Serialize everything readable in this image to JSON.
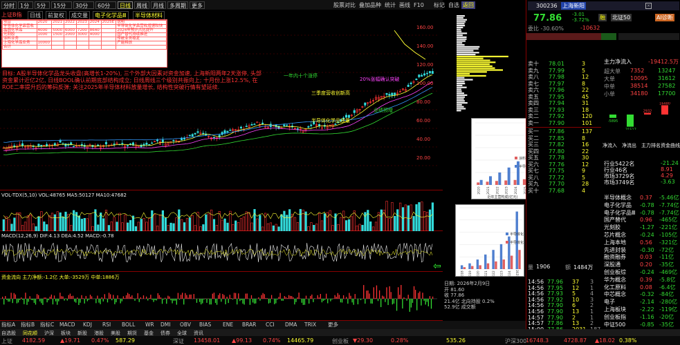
{
  "top_tabs": [
    "分时",
    "1分",
    "5分",
    "15分",
    "30分",
    "60分",
    "日线",
    "周线",
    "月线",
    "多周期",
    "更多"
  ],
  "top_right_tabs": [
    "股票对比",
    "叠加品种",
    "统计",
    "画线",
    "F10",
    "标记",
    "自选",
    "返回"
  ],
  "stock": {
    "code": "300236",
    "name": "上海新阳",
    "price": "77.86",
    "change": "-3.01",
    "pct": "-3.72%",
    "badge": "融",
    "rank_btn": "北证50",
    "diag_btn": "AI诊断"
  },
  "main_chart": {
    "label": "上证B指",
    "toolbar": [
      "日线",
      "前复权",
      "成交量",
      "电子化学品Ⅲ",
      "半导体材料"
    ],
    "y_labels": [
      "160.00",
      "140.00",
      "120.00",
      "100.00",
      "80.00",
      "60.00",
      "40.00",
      "20.00"
    ],
    "ind_line": "VOL-TDX(5,10)  VOL:48765  MA5:50127  MA10:47682"
  },
  "annotation_text": "目标: A股半导体化学品龙头收盘(高增长1-20%), 三个外部大因素对资金加速, 上海新阳两年2天涨停, 头部资金累计近亿2亿, 日线BOOL确认前期底部结构成立; 日线周线三个级别共振向上; 十月份上涨12.5%, 在ROE二率提升后的筹码反弹; 关注2025年半导体材料放量增长, 结构性突破行情有望延续.",
  "pinned_table": {
    "headers": [
      "项目",
      "2020",
      "2021",
      "2022",
      "2023",
      "2024",
      "2025E",
      "说明"
    ],
    "rows": [
      [
        "半导体化学品营收",
        "",
        "",
        "",
        "",
        "",
        "",
        "半导体化学品营收增速较快"
      ],
      [
        "晶圆化学品",
        "4000",
        "5000",
        "6000",
        "7200",
        "8640",
        "",
        "2024年预计占比提升"
      ],
      [
        "光刻胶",
        "1000",
        "1500",
        "2000",
        "3000",
        "4000",
        "",
        "国产替代持续推进"
      ],
      [
        "涂料业务",
        "",
        "",
        "",
        "",
        "",
        "",
        "传统业务稳定"
      ],
      [
        "上海化学品业务",
        "10000",
        "",
        "",
        "",
        "",
        "",
        "产能释放"
      ],
      [
        "合计",
        "",
        "",
        "",
        "",
        "",
        "",
        ""
      ]
    ]
  },
  "callouts": [
    {
      "text": "一年内十个涨停",
      "color": "#33dd33"
    },
    {
      "text": "三季度营收创新高",
      "color": "#ffff33"
    },
    {
      "text": "20%涨幅确认突破",
      "color": "#ff44ff"
    },
    {
      "text": "半导体化学品放量",
      "color": "#ffff33"
    },
    {
      "text": "业绩预增",
      "color": "#33dd33"
    }
  ],
  "indicator_tabs": [
    "指标A",
    "指标B",
    "指标C",
    "MACD",
    "KDJ",
    "RSI",
    "BOLL",
    "WR",
    "DMI",
    "OBV",
    "BIAS",
    "ENE",
    "BRAR",
    "CCI",
    "DMA",
    "TRIX",
    "更多"
  ],
  "indicator2_label": "MACD(12,26,9)  DIF:4.13  DEA:4.52  MACD:-0.78",
  "indicator3_label": "资金流向  主力净额:-1.2亿  大单:-3529万  中单:1886万",
  "right_panel": {
    "asks": [
      {
        "label": "卖十",
        "price": "78.01",
        "vol": "3"
      },
      {
        "label": "卖九",
        "price": "77.99",
        "vol": "5"
      },
      {
        "label": "卖八",
        "price": "77.98",
        "vol": "12"
      },
      {
        "label": "卖七",
        "price": "77.97",
        "vol": "8"
      },
      {
        "label": "卖六",
        "price": "77.96",
        "vol": "22"
      },
      {
        "label": "卖五",
        "price": "77.95",
        "vol": "45"
      },
      {
        "label": "卖四",
        "price": "77.94",
        "vol": "31"
      },
      {
        "label": "卖三",
        "price": "77.93",
        "vol": "18"
      },
      {
        "label": "卖二",
        "price": "77.92",
        "vol": "120"
      },
      {
        "label": "卖一",
        "price": "77.90",
        "vol": "101"
      }
    ],
    "bids": [
      {
        "label": "买一",
        "price": "77.86",
        "vol": "137"
      },
      {
        "label": "买二",
        "price": "77.85",
        "vol": "8"
      },
      {
        "label": "买三",
        "price": "77.82",
        "vol": "16"
      },
      {
        "label": "买四",
        "price": "77.80",
        "vol": "22"
      },
      {
        "label": "买五",
        "price": "77.78",
        "vol": "30"
      },
      {
        "label": "买六",
        "price": "77.76",
        "vol": "12"
      },
      {
        "label": "买七",
        "price": "77.75",
        "vol": "9"
      },
      {
        "label": "买八",
        "price": "77.72",
        "vol": "5"
      },
      {
        "label": "买九",
        "price": "77.70",
        "vol": "28"
      },
      {
        "label": "买十",
        "price": "77.68",
        "vol": "4"
      }
    ],
    "weibi": "委比 -30.60%",
    "weicha": "-10632",
    "flow_title": "主力净流入",
    "flow_value": "-19412.5万",
    "flow_rows": [
      {
        "k": "超大单",
        "in": "7352",
        "out": "13247"
      },
      {
        "k": "大单",
        "in": "10095",
        "out": "31612"
      },
      {
        "k": "中单",
        "in": "38514",
        "out": "27582"
      },
      {
        "k": "小单",
        "in": "34180",
        "out": "17700"
      }
    ],
    "flow_bar_labels": [
      "-5895",
      "-21517",
      "2932",
      "16480"
    ],
    "rank_tabs": [
      "净流入",
      "净流出",
      "主力排名",
      "资金曲线"
    ],
    "rank_rows": [
      {
        "name": "行业5422名",
        "v1": "-21.24"
      },
      {
        "name": "行业46名",
        "v1": "8.91"
      },
      {
        "name": "市场3729名",
        "v1": "4.29"
      },
      {
        "name": "市场3749名",
        "v1": "-3.63"
      }
    ],
    "sectors": [
      {
        "name": "半导体概念",
        "chg": "0.37",
        "val": "-5.46亿"
      },
      {
        "name": "电子化学品",
        "chg": "-0.78",
        "val": "-7.74亿"
      },
      {
        "name": "电子化学品Ⅲ",
        "chg": "-0.78",
        "val": "-7.74亿"
      },
      {
        "name": "国产替代",
        "chg": "0.96",
        "val": "-465亿"
      },
      {
        "name": "光刻胶",
        "chg": "-1.27",
        "val": "-221亿"
      },
      {
        "name": "芯片概念",
        "chg": "-0.24",
        "val": "-105亿"
      },
      {
        "name": "上海本地",
        "chg": "0.56",
        "val": "-321亿"
      },
      {
        "name": "先进封装",
        "chg": "-0.30",
        "val": "-72亿"
      },
      {
        "name": "融资融券",
        "chg": "0.03",
        "val": "-11亿"
      },
      {
        "name": "深股通",
        "chg": "0.20",
        "val": "-35亿"
      },
      {
        "name": "创业板综",
        "chg": "-0.24",
        "val": "-469亿"
      },
      {
        "name": "华为概念",
        "chg": "0.39",
        "val": "-5.8亿"
      },
      {
        "name": "化工原料",
        "chg": "0.08",
        "val": "-6.4亿"
      },
      {
        "name": "中芯概念",
        "chg": "-0.32",
        "val": "-84亿"
      },
      {
        "name": "电子",
        "chg": "-2.14",
        "val": "-280亿"
      },
      {
        "name": "上海板块",
        "chg": "-2.22",
        "val": "-119亿"
      },
      {
        "name": "创业板指",
        "chg": "-1.16",
        "val": "-20亿"
      },
      {
        "name": "中证500",
        "chg": "-0.85",
        "val": "-35亿"
      }
    ],
    "ticks": [
      {
        "t": "14:56",
        "p": "77.96",
        "v": "37",
        "c": "3"
      },
      {
        "t": "14:56",
        "p": "77.95",
        "v": "12",
        "c": "1"
      },
      {
        "t": "14:56",
        "p": "77.93",
        "v": "5",
        "c": "4"
      },
      {
        "t": "14:56",
        "p": "77.92",
        "v": "10",
        "c": "3"
      },
      {
        "t": "14:56",
        "p": "77.90",
        "v": "6",
        "c": "2"
      },
      {
        "t": "14:56",
        "p": "77.90",
        "v": "13",
        "c": "1"
      },
      {
        "t": "14:57",
        "p": "77.90",
        "v": "2",
        "c": "1"
      },
      {
        "t": "14:57",
        "p": "77.86",
        "v": "13",
        "c": "2"
      },
      {
        "t": "15:00",
        "p": "77.86",
        "v": "2031",
        "c": "187"
      }
    ],
    "bottom_stats": [
      {
        "k": "量",
        "v": "1906"
      },
      {
        "k": "额",
        "v": "1484万"
      }
    ]
  },
  "bottom_tabs": [
    "自选股",
    "同花顺",
    "沪深",
    "板块",
    "新股",
    "港股",
    "美股",
    "期货",
    "基金",
    "债券",
    "全球",
    "资讯"
  ],
  "bottom_stats": [
    {
      "k": "上证",
      "v": "4182.59",
      "c": "▲19.71",
      "p": "0.47%",
      "a": "587.29"
    },
    {
      "k": "深证",
      "v": "13458.01",
      "c": "▲99.13",
      "p": "0.74%",
      "a": "14465.79"
    },
    {
      "k": "创业板",
      "v": "▼29.30",
      "c": "0.28%",
      "p": "",
      "a": "535.26"
    },
    {
      "k": "沪深300",
      "v": "16748.3",
      "c": "4728.87",
      "p": "▲18.02",
      "a": "0.38%"
    }
  ],
  "chart_data": [
    {
      "type": "bar",
      "title": "",
      "categories": [
        "2020",
        "2021",
        "2022",
        "2023",
        "2024",
        "2025"
      ],
      "series": [
        {
          "name": "涂料",
          "values": [
            1.0,
            1.3,
            1.6,
            1.8,
            2.0,
            2.3
          ],
          "color": "#e06060"
        },
        {
          "name": "半导体",
          "values": [
            2.0,
            3.5,
            5.0,
            7.0,
            9.5,
            11.5
          ],
          "color": "#4f7fcf"
        }
      ],
      "xlabel": "近年主营构成(亿元)",
      "ylabel": "",
      "ylim": [
        0,
        25
      ]
    },
    {
      "type": "bar",
      "title": "",
      "categories": [
        "2018",
        "2019",
        "2020",
        "2021",
        "2022",
        "2023",
        "2024",
        "2025E"
      ],
      "series": [
        {
          "name": "半导体化学品营收(亿元)",
          "values": [
            1.0,
            1.5,
            2.5,
            3.8,
            5.0,
            6.5,
            8.5,
            15.0
          ],
          "color": "#4f7fcf"
        },
        {
          "name": "半导体化学品产能(万吨)",
          "values": [
            0.5,
            0.8,
            1.0,
            1.5,
            2.0,
            2.5,
            3.5,
            5.0
          ],
          "color": "#e06060"
        }
      ],
      "xlabel": "",
      "ylabel": "",
      "ylim": [
        0,
        16
      ]
    }
  ]
}
